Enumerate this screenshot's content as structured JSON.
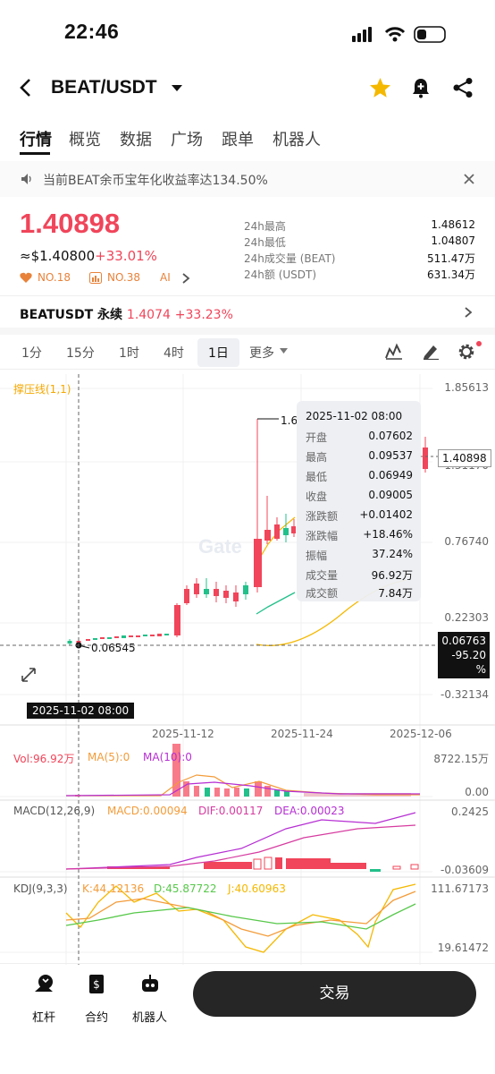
{
  "status": {
    "time": "22:46"
  },
  "header": {
    "pair": "BEAT/USDT"
  },
  "tabs": [
    "行情",
    "概览",
    "数据",
    "广场",
    "跟单",
    "机器人"
  ],
  "notice": {
    "text": "当前BEAT余币宝年化收益率达134.50%"
  },
  "price": {
    "last": "1.40898",
    "usd": "≈$1.40800",
    "change": "+33.01%",
    "badge1": "NO.18",
    "badge2": "NO.38",
    "ai": "AI"
  },
  "stats": [
    {
      "label": "24h最高",
      "value": "1.48612"
    },
    {
      "label": "24h最低",
      "value": "1.04807"
    },
    {
      "label": "24h成交量 (BEAT)",
      "value": "511.47万"
    },
    {
      "label": "24h额 (USDT)",
      "value": "631.34万"
    }
  ],
  "perp": {
    "name": "BEATUSDT 永续",
    "price": "1.4074",
    "change": "+33.23%"
  },
  "timeframes": [
    "1分",
    "15分",
    "1时",
    "4时",
    "1日",
    "更多"
  ],
  "chart": {
    "sar_label": "撑压线(1,1)",
    "y_labels": [
      "1.85613",
      "1.31170",
      "0.76740",
      "0.22303",
      "-0.32134"
    ],
    "last_price_tag": "1.40898",
    "cursor_tag": "0.06763",
    "cursor_pct": "-95.20 %",
    "low_mark": "0.06545",
    "high_mark": "1.6",
    "x_labels": [
      "2025-11-02 08:00",
      "2025-11-12",
      "2025-11-24",
      "2025-12-06"
    ],
    "watermark": "Gate"
  },
  "tooltip": {
    "date": "2025-11-02 08:00",
    "rows": [
      {
        "label": "开盘",
        "value": "0.07602"
      },
      {
        "label": "最高",
        "value": "0.09537"
      },
      {
        "label": "最低",
        "value": "0.06949"
      },
      {
        "label": "收盘",
        "value": "0.09005"
      },
      {
        "label": "涨跌额",
        "value": "+0.01402"
      },
      {
        "label": "涨跌幅",
        "value": "+18.46%"
      },
      {
        "label": "振幅",
        "value": "37.24%"
      },
      {
        "label": "成交量",
        "value": "96.92万"
      },
      {
        "label": "成交额",
        "value": "7.84万"
      }
    ]
  },
  "vol": {
    "label": "Vol:96.92万",
    "ma5": "MA(5):0",
    "ma10": "MA(10):0",
    "top": "8722.15万",
    "bottom": "0.00"
  },
  "macd": {
    "label": "MACD(12,26,9)",
    "macd": "MACD:0.00094",
    "dif": "DIF:0.00117",
    "dea": "DEA:0.00023",
    "top": "0.2425",
    "bottom": "-0.03609"
  },
  "kdj": {
    "label": "KDJ(9,3,3)",
    "k": "K:44.12136",
    "d": "D:45.87722",
    "j": "J:40.60963",
    "top": "111.67173",
    "bottom": "19.61472"
  },
  "bottom": {
    "lever": "杠杆",
    "contract": "合约",
    "robot": "机器人",
    "trade": "交易"
  },
  "colors": {
    "up": "#f0455a",
    "down": "#22c08a",
    "accent": "#f5b800"
  }
}
